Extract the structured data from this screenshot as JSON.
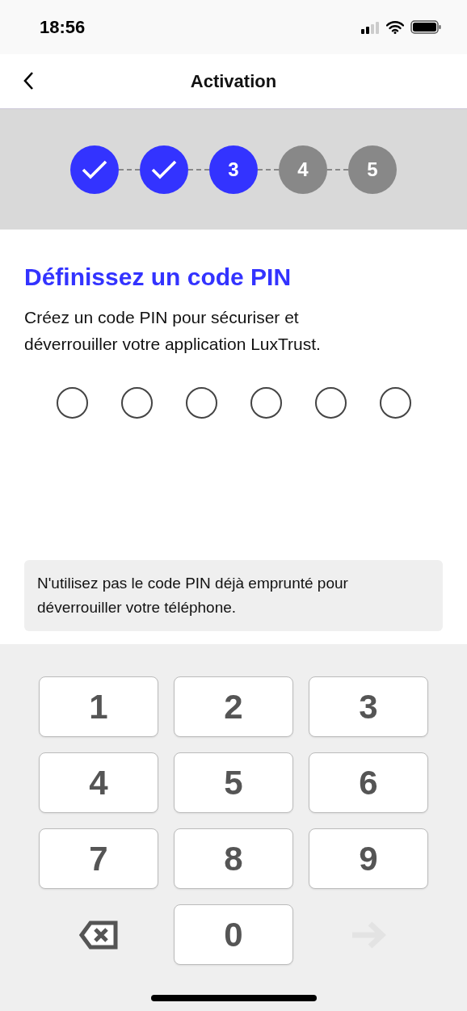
{
  "status_bar": {
    "time": "18:56"
  },
  "nav": {
    "title": "Activation"
  },
  "steps": [
    {
      "completed": true,
      "current": false
    },
    {
      "completed": true,
      "current": false
    },
    {
      "completed": false,
      "current": true,
      "label": "3"
    },
    {
      "completed": false,
      "current": false,
      "label": "4"
    },
    {
      "completed": false,
      "current": false,
      "label": "5"
    }
  ],
  "heading": "Définissez un code PIN",
  "description": "Créez un code PIN pour sécuriser et déverrouiller votre application LuxTrust.",
  "pin_dots": [
    {
      "filled": false
    },
    {
      "filled": false
    },
    {
      "filled": false
    },
    {
      "filled": false
    },
    {
      "filled": false
    },
    {
      "filled": false
    }
  ],
  "notice": "N'utilisez pas le code PIN déjà emprunté pour déverrouiller votre téléphone.",
  "keys": [
    {
      "kind": "digit",
      "label": "1"
    },
    {
      "kind": "digit",
      "label": "2"
    },
    {
      "kind": "digit",
      "label": "3"
    },
    {
      "kind": "digit",
      "label": "4"
    },
    {
      "kind": "digit",
      "label": "5"
    },
    {
      "kind": "digit",
      "label": "6"
    },
    {
      "kind": "digit",
      "label": "7"
    },
    {
      "kind": "digit",
      "label": "8"
    },
    {
      "kind": "digit",
      "label": "9"
    },
    {
      "kind": "backspace",
      "disabled": false
    },
    {
      "kind": "digit",
      "label": "0"
    },
    {
      "kind": "next",
      "disabled": true
    }
  ]
}
